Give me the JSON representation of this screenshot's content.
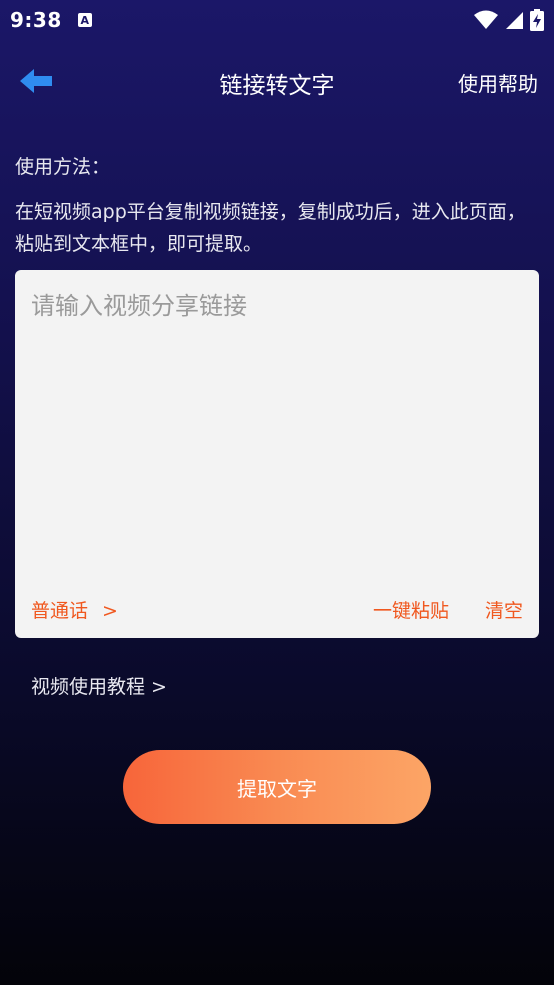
{
  "status_bar": {
    "time": "9:38",
    "app_icon_letter": "A",
    "icons": [
      "wifi-icon",
      "signal-icon",
      "battery-charging-icon"
    ]
  },
  "app_bar": {
    "title": "链接转文字",
    "help_label": "使用帮助",
    "back_icon": "back-arrow-icon",
    "accent_color": "#2f8cf0"
  },
  "usage": {
    "title": "使用方法：",
    "description": "在短视频app平台复制视频链接，复制成功后，进入此页面，粘贴到文本框中，即可提取。"
  },
  "input": {
    "placeholder": "请输入视频分享链接",
    "value": "",
    "language_label": "普通话",
    "language_chevron": ">",
    "paste_label": "一键粘贴",
    "clear_label": "清空",
    "action_color": "#f0581f"
  },
  "tutorial": {
    "label": "视频使用教程 >"
  },
  "extract_button": {
    "label": "提取文字",
    "gradient": [
      "#f7653a",
      "#fca566"
    ]
  }
}
